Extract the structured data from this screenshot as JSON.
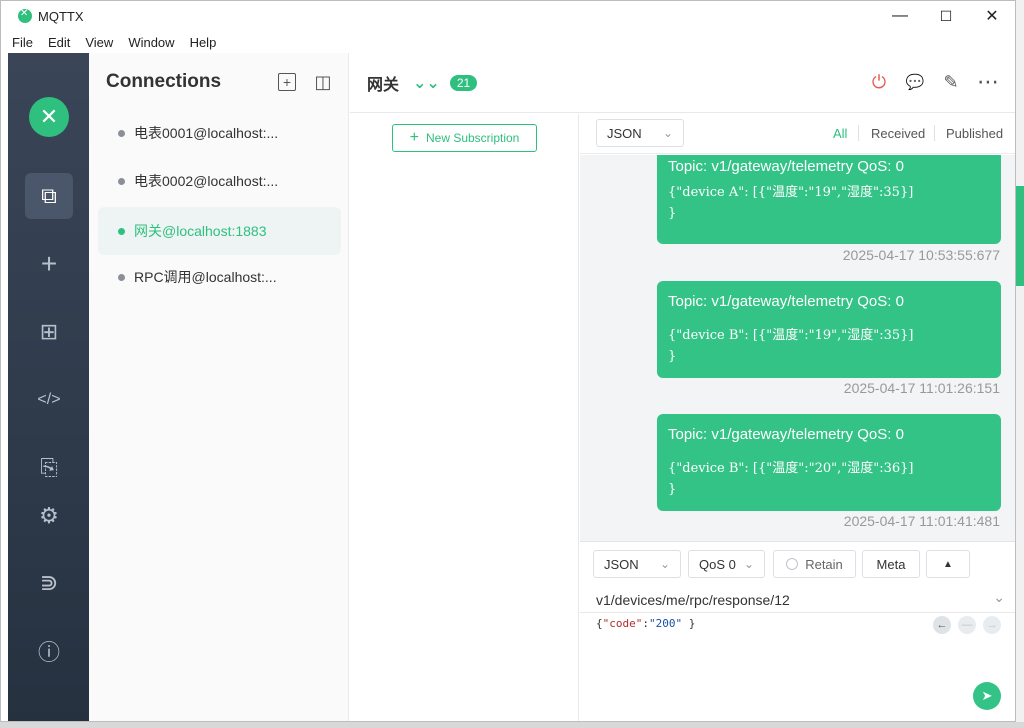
{
  "window": {
    "title": "MQTTX",
    "minimize": "—",
    "maximize": "☐",
    "close": "✕"
  },
  "menu": [
    "File",
    "Edit",
    "View",
    "Window",
    "Help"
  ],
  "nav": {
    "logo_glyph": "✕",
    "items": [
      {
        "name": "connections-icon",
        "glyph": "⧉",
        "active": true
      },
      {
        "name": "add-icon",
        "glyph": "+"
      },
      {
        "name": "topology-icon",
        "glyph": "⊞"
      },
      {
        "name": "script-icon",
        "glyph": "</>"
      },
      {
        "name": "log-icon",
        "glyph": "⎘"
      },
      {
        "name": "settings-icon",
        "glyph": "⚙"
      },
      {
        "name": "subscribe-icon",
        "glyph": "⋑"
      },
      {
        "name": "about-icon",
        "glyph": "ⓘ"
      }
    ]
  },
  "connections": {
    "title": "Connections",
    "new_glyph": "+",
    "layout_glyph": "◫",
    "items": [
      {
        "label": "电表0001@localhost:...",
        "active": false
      },
      {
        "label": "电表0002@localhost:...",
        "active": false
      },
      {
        "label": "网关@localhost:1883",
        "active": true
      },
      {
        "label": "RPC调用@localhost:...",
        "active": false
      }
    ]
  },
  "header": {
    "title": "网关",
    "collapse_glyph": "⌄⌄",
    "badge": "21",
    "actions": {
      "disconnect": "⏻",
      "chat": "💬",
      "edit": "✎",
      "more": "⋯"
    }
  },
  "subscriptions": {
    "new_label": "New Subscription",
    "plus": "+"
  },
  "toolbar": {
    "format": "JSON",
    "arrow": "⌄",
    "tabs": [
      "All",
      "Received",
      "Published"
    ]
  },
  "messages": [
    {
      "topic": "Topic: v1/gateway/telemetry   QoS: 0",
      "line1": "{\"device A\": [{\"温度\":\"19\",\"湿度\":35}]",
      "line2": "}",
      "time": "2025-04-17 10:53:55:677"
    },
    {
      "topic": "Topic: v1/gateway/telemetry   QoS: 0",
      "line1": "{\"device B\": [{\"温度\":\"19\",\"湿度\":35}]",
      "line2": "}",
      "time": "2025-04-17 11:01:26:151"
    },
    {
      "topic": "Topic: v1/gateway/telemetry   QoS: 0",
      "line1": "{\"device B\": [{\"温度\":\"20\",\"湿度\":36}]",
      "line2": "}",
      "time": "2025-04-17 11:01:41:481"
    }
  ],
  "publish": {
    "format": "JSON",
    "qos": "QoS 0",
    "retain": "Retain",
    "meta": "Meta",
    "expand": "▲",
    "topic": "v1/devices/me/rpc/response/12",
    "payload_open": "{",
    "payload_key": "\"code\"",
    "payload_colon": ":",
    "payload_val": "\"200\"",
    "payload_close": " }",
    "prev": "←",
    "reset": "—",
    "next": "→",
    "send": "➤"
  }
}
